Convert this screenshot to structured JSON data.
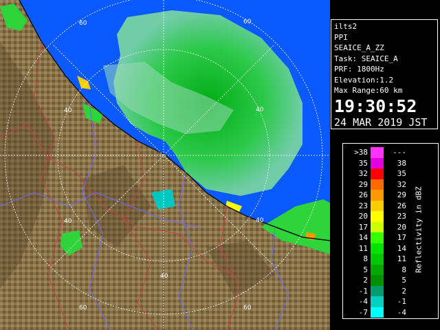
{
  "info": {
    "station": "ilts2",
    "product": "PPI",
    "product_name": "SEAICE_A_ZZ",
    "task": "Task: SEAICE_A",
    "prf": "PRF: 1800Hz",
    "elevation": "Elevation:1.2",
    "max_range": "Max Range:60 km",
    "time": "19:30:52",
    "date": "24 MAR 2019 JST"
  },
  "legend": {
    "title": "Reflectivity in dBZ",
    "rows": [
      {
        "lo": ">38",
        "hi": "---",
        "color": "#ff33ff"
      },
      {
        "lo": "35",
        "hi": "38",
        "color": "#e000e0"
      },
      {
        "lo": "32",
        "hi": "35",
        "color": "#ff0000"
      },
      {
        "lo": "29",
        "hi": "32",
        "color": "#ff6a00"
      },
      {
        "lo": "26",
        "hi": "29",
        "color": "#ff9900"
      },
      {
        "lo": "23",
        "hi": "26",
        "color": "#ffcc00"
      },
      {
        "lo": "20",
        "hi": "23",
        "color": "#ffff00"
      },
      {
        "lo": "17",
        "hi": "20",
        "color": "#ccff00"
      },
      {
        "lo": "14",
        "hi": "17",
        "color": "#33ff00"
      },
      {
        "lo": "11",
        "hi": "14",
        "color": "#00e400"
      },
      {
        "lo": "8",
        "hi": "11",
        "color": "#00c800"
      },
      {
        "lo": "5",
        "hi": "8",
        "color": "#00a800"
      },
      {
        "lo": "2",
        "hi": "5",
        "color": "#009000"
      },
      {
        "lo": "-1",
        "hi": "2",
        "color": "#009c70"
      },
      {
        "lo": "-4",
        "hi": "-1",
        "color": "#00d0c0"
      },
      {
        "lo": "-7",
        "hi": "-4",
        "color": "#00ffff"
      }
    ]
  },
  "map": {
    "range_labels": [
      "60",
      "60",
      "40",
      "40",
      "40",
      "40",
      "40",
      "60",
      "60"
    ],
    "colors": {
      "sea": "#0a5aff",
      "land": "#86704a",
      "land_dark": "#5e4a2e",
      "echo": "#2fd33a"
    }
  }
}
